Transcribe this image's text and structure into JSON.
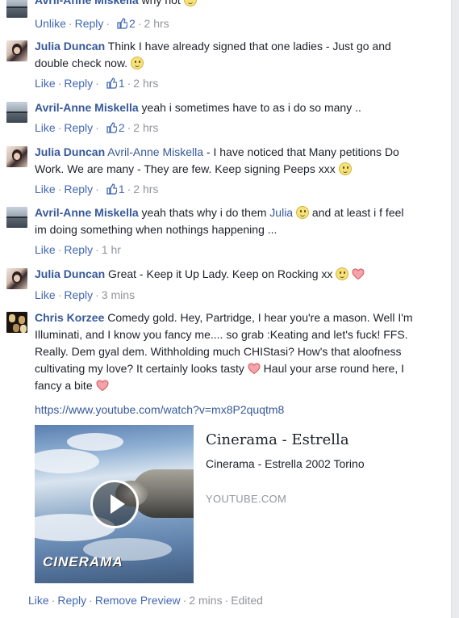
{
  "actions": {
    "like": "Like",
    "unlike": "Unlike",
    "reply": "Reply",
    "remove_preview": "Remove Preview",
    "edited": "Edited"
  },
  "comments": [
    {
      "name": "Avril-Anne Miskella",
      "text": "why not",
      "action": "Unlike",
      "likes": "2",
      "time": "2 hrs"
    },
    {
      "name": "Julia Duncan",
      "text": "Think I have already signed that one ladies - Just go and double check now.",
      "action": "Like",
      "likes": "1",
      "time": "2 hrs"
    },
    {
      "name": "Avril-Anne Miskella",
      "text": "yeah i sometimes have to as i do so many ..",
      "action": "Like",
      "likes": "2",
      "time": "2 hrs"
    },
    {
      "name": "Julia Duncan",
      "mention": "Avril-Anne Miskella",
      "text": " - I have noticed that Many petitions Do Work. We are many - They are few. Keep signing Peeps xxx",
      "action": "Like",
      "likes": "1",
      "time": "2 hrs"
    },
    {
      "name": "Avril-Anne Miskella",
      "text": "yeah thats why i do them",
      "mention": "Julia",
      "text2": "and at least i f feel im doing something when nothings happening ...",
      "action": "Like",
      "time": "1 hr"
    },
    {
      "name": "Julia Duncan",
      "text": "Great - Keep it Up Lady. Keep on Rocking xx",
      "action": "Like",
      "time": "3 mins"
    },
    {
      "name": "Chris Korzee",
      "text": "Comedy gold. Hey, Partridge, I hear you're a mason. Well I'm Illuminati, and I know you fancy me.... so grab :Keating and let's fuck! FFS. Really. Dem gyal dem. Withholding much CHIStasi? How's that aloofness cultivating my love? It certainly looks tasty",
      "text2": "Haul your arse round here, I fancy a bite",
      "action": "Like",
      "time": "2 mins"
    }
  ],
  "link": {
    "url": "https://www.youtube.com/watch?v=mx8P2quqtm8",
    "title": "Cinerama - Estrella",
    "description": "Cinerama - Estrella 2002 Torino",
    "domain": "YOUTUBE.COM",
    "thumbnail_text": "CINERAMA"
  },
  "icons": {
    "avatar": "profile-photo",
    "like_count": "thumbs-up-icon",
    "smiley": "smiley-emoji",
    "heart": "heart-emoji",
    "play": "play-icon"
  },
  "colors": {
    "name": "#365899",
    "link": "#4267b2",
    "meta": "#90949c",
    "text": "#1d2129"
  }
}
